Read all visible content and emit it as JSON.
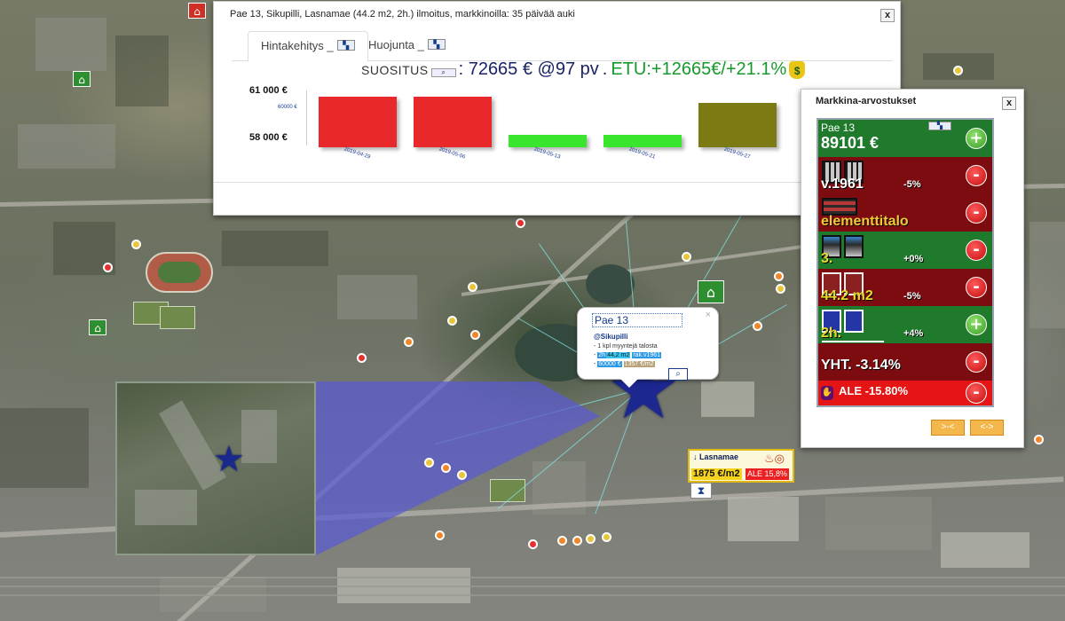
{
  "dialog": {
    "title": "Pae 13, Sikupilli, Lasnamae (44.2 m2, 2h.) ilmoitus, markkinoilla: 35 päivää auki",
    "close_label": "x",
    "tabs": [
      {
        "label": "Hintakehitys _",
        "icon": "chart-icon"
      },
      {
        "label": "Huojunta _",
        "icon": "chart-icon"
      }
    ],
    "suggestion": {
      "label": "SUOSITUS",
      "price": ": 72665 € @97 pv",
      "separator": ".",
      "gain": "ETU:+12665€/+21.1%",
      "icon": "money-bag-icon"
    }
  },
  "chart_data": {
    "type": "bar",
    "categories": [
      "2019-04-29",
      "2019-05-06",
      "2019-05-13",
      "2019-05-21",
      "2019-05-27"
    ],
    "values": [
      61000,
      61000,
      58000,
      58000,
      60500
    ],
    "colors": [
      "#e8282b",
      "#e8282b",
      "#39e62d",
      "#39e62d",
      "#7b7a13"
    ],
    "yticks": [
      "61 000 €",
      "58 000 €"
    ],
    "ymid_label": "60000 €",
    "ylim": [
      57000,
      61500
    ]
  },
  "valuation": {
    "title": "Markkina-arvostukset",
    "close_label": "x",
    "header": {
      "name": "Pae 13",
      "price": "89101 €"
    },
    "rows": [
      {
        "label": "v.1961",
        "pct": "-5%",
        "color": "r",
        "button": "-",
        "icon": "building-icon"
      },
      {
        "label": "elementtitalo",
        "pct": "",
        "color": "r",
        "button": "-",
        "icon": "panel-house-icon"
      },
      {
        "label": "3.",
        "pct": "+0%",
        "color": "g",
        "button": "-",
        "icon": "floor-icon"
      },
      {
        "label": "44.2 m2",
        "pct": "-5%",
        "color": "r",
        "button": "-",
        "icon": "floorplan-icon"
      },
      {
        "label": "2h.",
        "pct": "+4%",
        "color": "g",
        "button": "+",
        "icon": "rooms-icon"
      }
    ],
    "total": "YHT. -3.14%",
    "ale": "ALE -15.80%",
    "nav": [
      ">-<",
      "<->"
    ]
  },
  "popup": {
    "title": "Pae 13",
    "close": "×",
    "subtitle": "@Sikupilli",
    "line1": "- 1 kpl myyntejä talosta",
    "line2_prefix": "- ",
    "line2_a": "2h",
    "line2_b": "44,2 m2",
    "line2_c": "rak.v1961",
    "line3_prefix": "- ",
    "line3_a": "60000 €",
    "line3_b": "1357 €/m2"
  },
  "area": {
    "name": "Lasnamae",
    "price": "1875 €/m2",
    "ale": "ALE 15,8%"
  }
}
